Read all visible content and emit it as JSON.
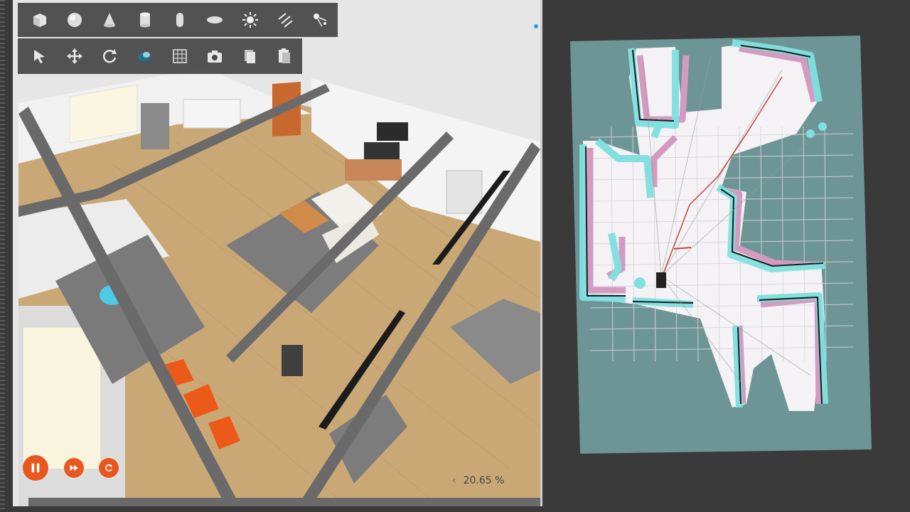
{
  "simulator": {
    "toolbar_shapes": [
      {
        "name": "box-icon"
      },
      {
        "name": "sphere-icon"
      },
      {
        "name": "cone-icon"
      },
      {
        "name": "cylinder-icon"
      },
      {
        "name": "capsule-icon"
      },
      {
        "name": "ellipsoid-icon"
      },
      {
        "name": "sun-light-icon"
      },
      {
        "name": "directional-light-icon"
      },
      {
        "name": "spot-light-icon"
      }
    ],
    "toolbar_tools": [
      {
        "name": "select-arrow-icon"
      },
      {
        "name": "translate-icon"
      },
      {
        "name": "rotate-icon"
      },
      {
        "name": "scale-icon"
      },
      {
        "name": "grid-snap-icon"
      },
      {
        "name": "screenshot-camera-icon"
      },
      {
        "name": "copy-icon"
      },
      {
        "name": "paste-icon"
      }
    ],
    "controls": {
      "pause": "pause-icon",
      "step": "fast-forward-icon",
      "reset": "reset-icon"
    },
    "real_time_factor": "20.65 %",
    "collapse_arrow": "‹"
  },
  "colors": {
    "control_orange": "#e8571e",
    "toolbar_bg": "#4a4a4a",
    "map_unknown": "#6e9595",
    "map_free": "#f4f2f5",
    "costmap_cyan": "#7fe0df",
    "costmap_pink": "#d39bc0",
    "path_red": "#c0463c"
  }
}
